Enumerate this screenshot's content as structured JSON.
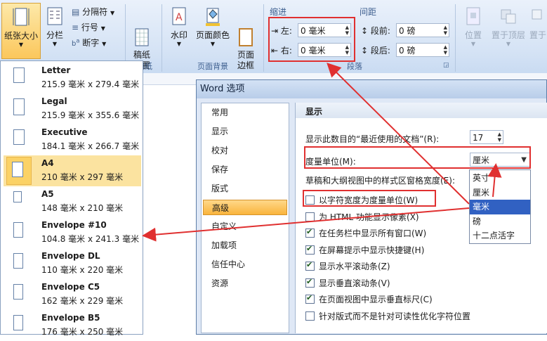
{
  "ribbon": {
    "paper_size_label": "纸张大小",
    "columns_label": "分栏",
    "breaks_label": "分隔符",
    "line_numbers_label": "行号",
    "hyphenation_label": "断字",
    "manuscript_label": "稿纸\n设置",
    "manuscript_group": "稿纸",
    "watermark_label": "水印",
    "page_color_label": "页面颜色",
    "page_border_label": "页面\n边框",
    "page_bg_group": "页面背景",
    "indent_header": "缩进",
    "spacing_header": "间距",
    "indent_left_label": "左:",
    "indent_left_value": "0 毫米",
    "indent_right_label": "右:",
    "indent_right_value": "0 毫米",
    "spacing_before_label": "段前:",
    "spacing_before_value": "0 磅",
    "spacing_after_label": "段后:",
    "spacing_after_value": "0 磅",
    "paragraph_group": "段落",
    "position_label": "位置",
    "bring_front_label": "置于顶层",
    "send_back_label": "置于"
  },
  "paper_sizes": [
    {
      "name": "Letter",
      "size": "215.9 毫米 x 279.4 毫米"
    },
    {
      "name": "Legal",
      "size": "215.9 毫米 x 355.6 毫米"
    },
    {
      "name": "Executive",
      "size": "184.1 毫米 x 266.7 毫米"
    },
    {
      "name": "A4",
      "size": "210 毫米 x 297 毫米"
    },
    {
      "name": "A5",
      "size": "148 毫米 x 210 毫米"
    },
    {
      "name": "Envelope #10",
      "size": "104.8 毫米 x 241.3 毫米"
    },
    {
      "name": "Envelope DL",
      "size": "110 毫米 x 220 毫米"
    },
    {
      "name": "Envelope C5",
      "size": "162 毫米 x 229 毫米"
    },
    {
      "name": "Envelope B5",
      "size": "176 毫米 x 250 毫米"
    }
  ],
  "dialog": {
    "title": "Word 选项",
    "nav": [
      "常用",
      "显示",
      "校对",
      "保存",
      "版式",
      "高级",
      "自定义",
      "加载项",
      "信任中心",
      "资源"
    ],
    "section_title": "显示",
    "recent_docs_label": "显示此数目的“最近使用的文档”(R):",
    "recent_docs_value": "17",
    "units_label": "度量单位(M):",
    "units_value": "厘米",
    "style_width_label": "草稿和大纲视图中的样式区窗格宽度(E):",
    "units_options": [
      "英寸",
      "厘米",
      "毫米",
      "磅",
      "十二点活字"
    ],
    "options": [
      {
        "label": "以字符宽度为度量单位(W)",
        "checked": false
      },
      {
        "label": "为 HTML 功能显示像素(X)",
        "checked": false
      },
      {
        "label": "在任务栏中显示所有窗口(W)",
        "checked": true
      },
      {
        "label": "在屏幕提示中显示快捷键(H)",
        "checked": true
      },
      {
        "label": "显示水平滚动条(Z)",
        "checked": true
      },
      {
        "label": "显示垂直滚动条(V)",
        "checked": true
      },
      {
        "label": "在页面视图中显示垂直标尺(C)",
        "checked": true
      },
      {
        "label": "针对版式而不是针对可读性优化字符位置",
        "checked": false
      }
    ]
  },
  "colors": {
    "annotation_red": "#e03030",
    "selection_blue": "#3161c2",
    "active_orange": "#f9b43c"
  }
}
